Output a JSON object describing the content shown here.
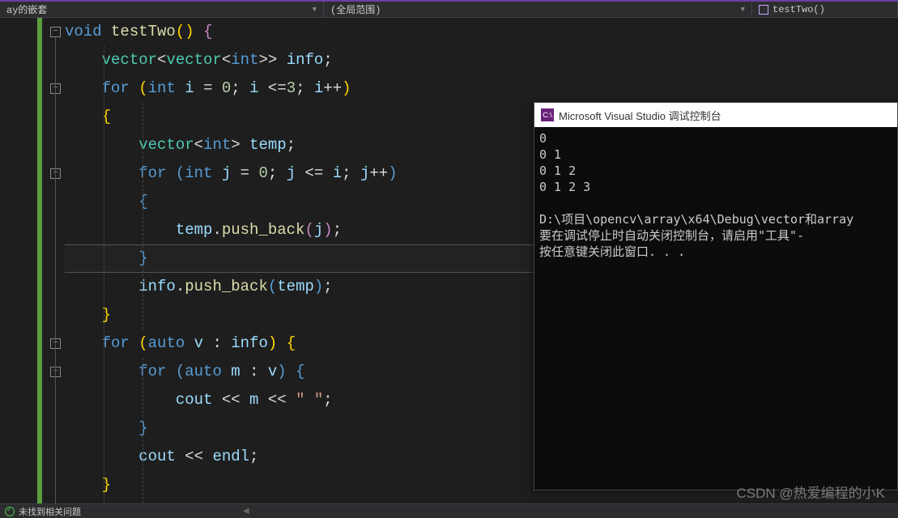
{
  "topbar": {
    "seg1": "ay的嵌套",
    "seg2": "(全局范围)",
    "seg3": "testTwo()"
  },
  "tok": {
    "void": "void",
    "testTwo": "testTwo",
    "lparen": "(",
    "rparen": ")",
    "vector": "vector",
    "int": "int",
    "info": "info",
    "temp": "temp",
    "for": "for",
    "i": "i",
    "j": "j",
    "v": "v",
    "m": "m",
    "zero": "0",
    "three": "3",
    "auto": "auto",
    "cout": "cout",
    "endl": "endl",
    "push_back": "push_back",
    "semi": ";",
    "comma": ",",
    "eq": " = ",
    "lte": " <=",
    "inc": "++",
    "colon": " : ",
    "lbrace": "{",
    "rbrace": "}",
    "lt": "<",
    "gt": ">",
    "ltlt": " << ",
    "spacestr": "\" \""
  },
  "console": {
    "title": "Microsoft Visual Studio 调试控制台",
    "icon": "C:\\",
    "out1": "0",
    "out2": "0 1",
    "out3": "0 1 2",
    "out4": "0 1 2 3",
    "blank": "",
    "path": "D:\\项目\\opencv\\array\\x64\\Debug\\vector和array",
    "msg1": "要在调试停止时自动关闭控制台，请启用\"工具\"-",
    "msg2": "按任意键关闭此窗口. . ."
  },
  "status": {
    "text": "未找到相关问题"
  },
  "watermark": "CSDN @热爱编程的小K"
}
